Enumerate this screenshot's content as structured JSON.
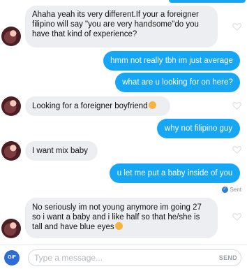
{
  "messages": [
    {
      "dir": "in",
      "text": "Ahaha yeah its very different.If your a foreigner filipino will say \"you are very handsome\"do you have that kind of experience?"
    },
    {
      "dir": "out",
      "text": "hmm not really tbh im just average"
    },
    {
      "dir": "out",
      "text": "what are u looking for on here?"
    },
    {
      "dir": "in",
      "text": "Looking for a foreigner boyfriend",
      "emoji": "smiling-face-emoji"
    },
    {
      "dir": "out",
      "text": "why not filipino guy"
    },
    {
      "dir": "in",
      "text": "I want mix baby"
    },
    {
      "dir": "out",
      "text": "u let me put a baby inside of you"
    },
    {
      "dir": "in",
      "text": "No seriously im not young anymore im going 27 so i want a baby and i like half so that he/she is tall and have blue eyes",
      "emoji": "smiling-face-emoji"
    }
  ],
  "status": {
    "sent_label": "Sent"
  },
  "composer": {
    "gif_label": "GIF",
    "placeholder": "Type a message...",
    "send_label": "SEND"
  },
  "colors": {
    "outgoing": "#16a6f4",
    "incoming": "#eceef1",
    "gif_button": "#2e6dd6"
  },
  "icons": {
    "like": "heart-outline-icon",
    "sent": "check-circle-icon"
  }
}
